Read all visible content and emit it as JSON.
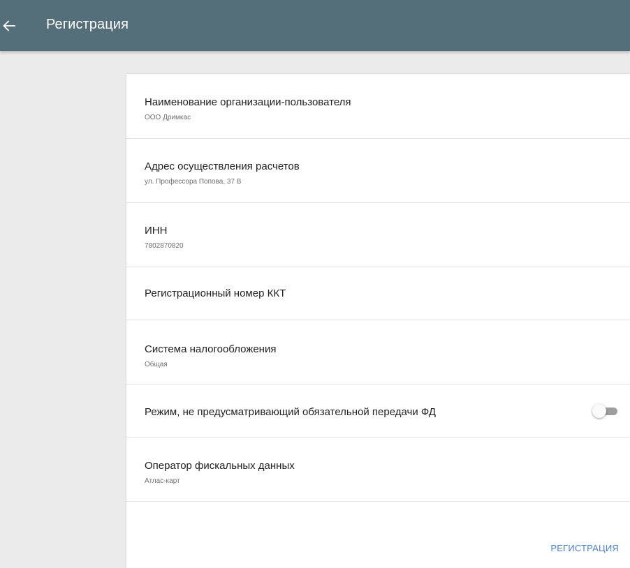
{
  "toolbar": {
    "back_icon": "arrow-left-icon",
    "title": "Регистрация",
    "background_color": "#546e7a"
  },
  "form": {
    "rows": [
      {
        "title": "Наименование организации-пользователя",
        "value": "ООО Дримкас"
      },
      {
        "title": "Адрес осуществления расчетов",
        "value": "ул. Профессора Попова, 37 В"
      },
      {
        "title": "ИНН",
        "value": "7802870820"
      },
      {
        "title": "Регистрационный номер ККТ",
        "value": ""
      },
      {
        "title": "Система налогообложения",
        "value": "Общая"
      },
      {
        "title": "Режим, не предусматривающий обязательной передачи ФД",
        "toggle_on": false
      },
      {
        "title": "Оператор фискальных данных",
        "value": "Атлас-карт"
      }
    ]
  },
  "actions": {
    "register_label": "РЕГИСТРАЦИЯ",
    "accent_color": "#4a7fd6"
  }
}
